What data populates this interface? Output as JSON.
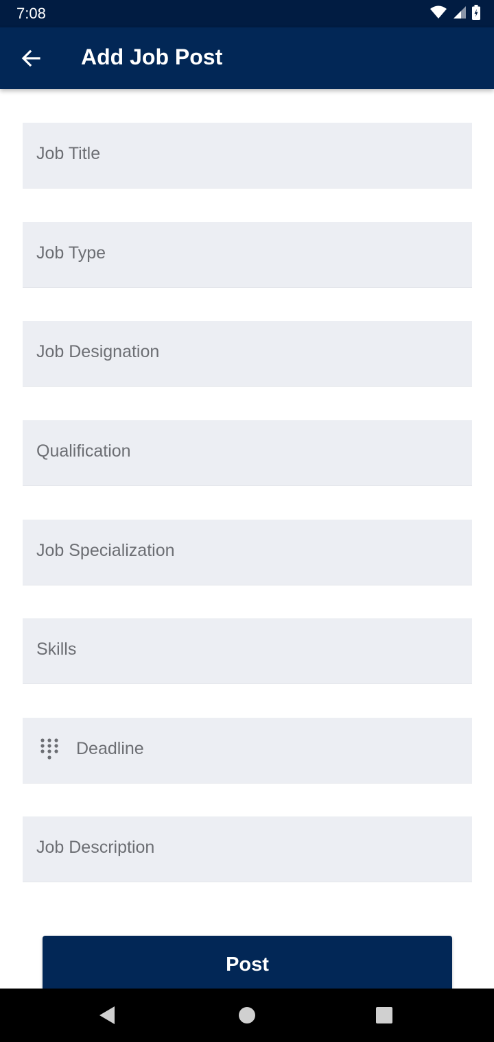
{
  "status_bar": {
    "time": "7:08",
    "icons": [
      "wifi-icon",
      "cellular-signal-icon",
      "battery-icon"
    ]
  },
  "app_bar": {
    "back_icon": "arrow-left-icon",
    "title": "Add Job Post"
  },
  "form": {
    "fields": [
      {
        "label": "Job Title"
      },
      {
        "label": "Job Type"
      },
      {
        "label": "Job Designation"
      },
      {
        "label": "Qualification"
      },
      {
        "label": "Job Specialization"
      },
      {
        "label": "Skills"
      },
      {
        "label": "Deadline",
        "icon": "dialpad-icon"
      },
      {
        "label": "Job Description"
      }
    ]
  },
  "post_button": {
    "label": "Post"
  },
  "nav_bar": {
    "icons": [
      "back-triangle-icon",
      "home-circle-icon",
      "recents-square-icon"
    ]
  },
  "colors": {
    "status_bar": "#011c42",
    "primary": "#022756",
    "field_background": "#eceef3",
    "label_text": "#6c6e73"
  }
}
